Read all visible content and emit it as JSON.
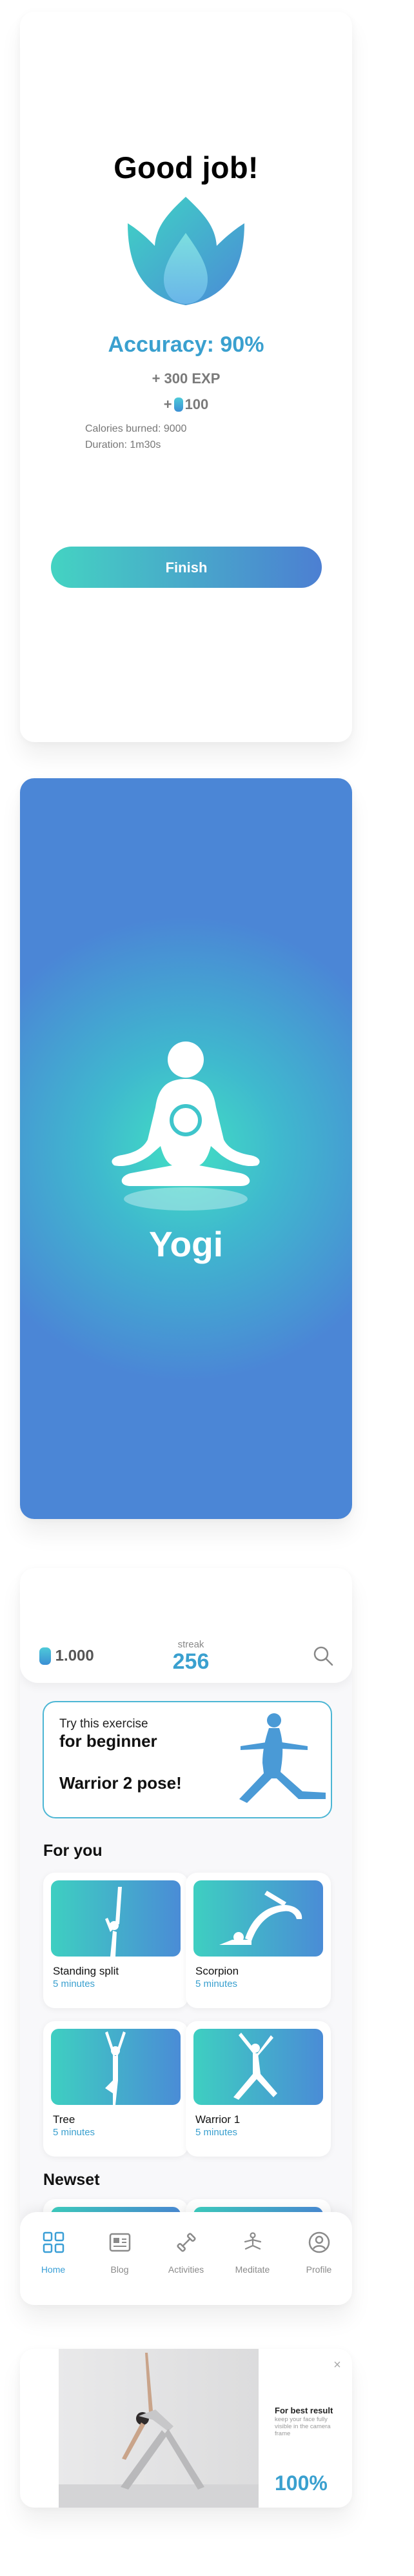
{
  "result": {
    "title": "Good job!",
    "accuracy": "Accuracy: 90%",
    "exp": "+ 300 EXP",
    "coins_prefix": "+",
    "coins": "100",
    "calories": "Calories burned: 9000",
    "duration": "Duration: 1m30s",
    "finish_label": "Finish"
  },
  "splash": {
    "app_name": "Yogi"
  },
  "home": {
    "balance": "1.000",
    "streak_label": "streak",
    "streak_value": "256",
    "featured": {
      "line1": "Try this exercise",
      "line2": "for beginner",
      "pose": "Warrior 2 pose!"
    },
    "for_you_title": "For you",
    "newset_title": "Newset",
    "for_you": [
      {
        "name": "Standing split",
        "duration": "5 minutes"
      },
      {
        "name": "Scorpion",
        "duration": "5 minutes"
      },
      {
        "name": "Tree",
        "duration": "5 minutes"
      },
      {
        "name": "Warrior 1",
        "duration": "5 minutes"
      }
    ],
    "tabs": [
      {
        "label": "Home",
        "icon": "home-grid-icon",
        "active": true
      },
      {
        "label": "Blog",
        "icon": "blog-icon",
        "active": false
      },
      {
        "label": "Activities",
        "icon": "activities-icon",
        "active": false
      },
      {
        "label": "Meditate",
        "icon": "meditate-icon",
        "active": false
      },
      {
        "label": "Profile",
        "icon": "profile-icon",
        "active": false
      }
    ]
  },
  "camera": {
    "close_label": "×",
    "tip_title": "For best result",
    "tip_body": "keep your face fully visible in the camera frame",
    "progress": "100%"
  },
  "colors": {
    "accent_blue": "#3aa0cf",
    "gradient_start": "#44d3c2",
    "gradient_end": "#4c7fd2"
  }
}
